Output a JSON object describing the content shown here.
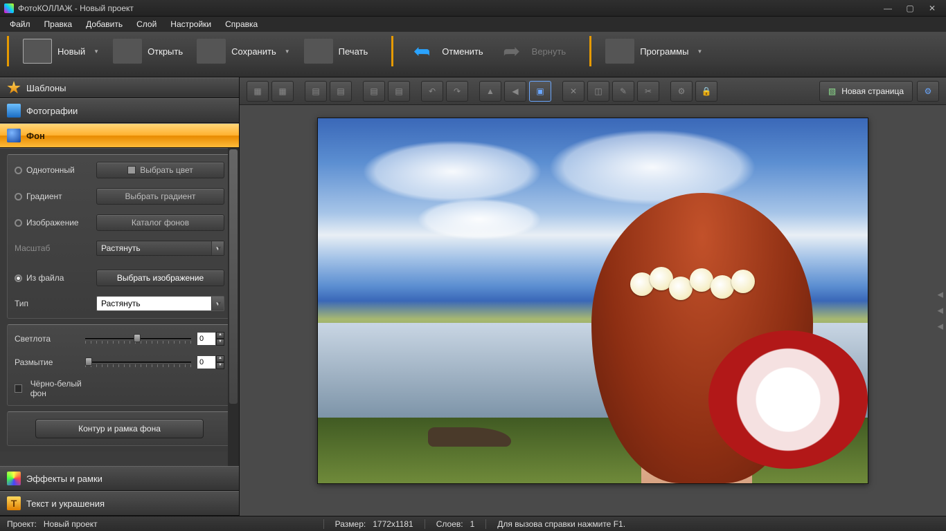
{
  "title": "ФотоКОЛЛАЖ - Новый проект",
  "menu": {
    "file": "Файл",
    "edit": "Правка",
    "add": "Добавить",
    "layer": "Слой",
    "settings": "Настройки",
    "help": "Справка"
  },
  "toolbar": {
    "new": "Новый",
    "open": "Открыть",
    "save": "Сохранить",
    "print": "Печать",
    "undo": "Отменить",
    "redo": "Вернуть",
    "programs": "Программы"
  },
  "editbar": {
    "newpage": "Новая страница"
  },
  "sidebar": {
    "templates": "Шаблоны",
    "photos": "Фотографии",
    "background": "Фон",
    "panel": {
      "solid": "Однотонный",
      "choose_color": "Выбрать цвет",
      "gradient": "Градиент",
      "choose_gradient": "Выбрать градиент",
      "image": "Изображение",
      "bg_catalog": "Каталог фонов",
      "scale": "Масштаб",
      "scale_value": "Растянуть",
      "from_file": "Из файла",
      "choose_image": "Выбрать изображение",
      "type": "Тип",
      "type_value": "Растянуть",
      "brightness": "Светлота",
      "brightness_value": "0",
      "blur": "Размытие",
      "blur_value": "0",
      "bw": "Чёрно-белый фон",
      "contour": "Контур и рамка фона"
    },
    "effects": "Эффекты и рамки",
    "text": "Текст и украшения"
  },
  "status": {
    "project_label": "Проект:",
    "project": "Новый проект",
    "size_label": "Размер:",
    "size": "1772x1181",
    "layers_label": "Слоев:",
    "layers": "1",
    "help": "Для вызова справки нажмите F1."
  }
}
